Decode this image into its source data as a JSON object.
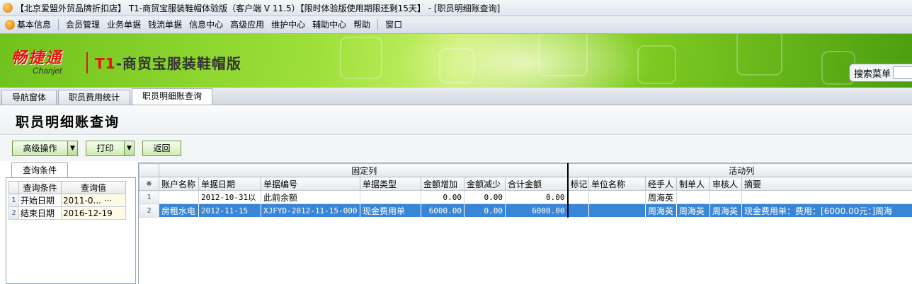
{
  "window": {
    "title": "【北京爱盟外贸品牌折扣店】 T1-商贸宝服装鞋帽体验版（客户端 V 11.5）【限时体验版使用期限还剩15天】 - [职员明细账查询]"
  },
  "menu": {
    "items": [
      "基本信息",
      "会员管理",
      "业务单据",
      "钱流单据",
      "信息中心",
      "高级应用",
      "维护中心",
      "辅助中心",
      "帮助",
      "窗口"
    ]
  },
  "banner": {
    "logo_cn": "畅捷通",
    "logo_en": "Chanjet",
    "product_prefix": "T1",
    "product_name": "-商贸宝服装鞋帽版",
    "search_label": "搜索菜单"
  },
  "tabs": [
    "导航窗体",
    "职员费用统计",
    "职员明细账查询"
  ],
  "active_tab": 2,
  "page": {
    "title": "职员明细账查询"
  },
  "toolbar": {
    "advanced": "高级操作",
    "print": "打印",
    "back": "返回"
  },
  "query_panel": {
    "tab": "查询条件",
    "headers": [
      "查询条件",
      "查询值"
    ],
    "rows": [
      {
        "n": "1",
        "label": "开始日期",
        "value": "2011-0...",
        "more": "···"
      },
      {
        "n": "2",
        "label": "结束日期",
        "value": "2016-12-19",
        "more": ""
      }
    ]
  },
  "grid": {
    "group_fixed": "固定列",
    "group_active": "活动列",
    "corner": "※",
    "columns": [
      "账户名称",
      "单据日期",
      "单据编号",
      "单据类型",
      "金额增加",
      "金额减少",
      "合计金额",
      "标记",
      "单位名称",
      "经手人",
      "制单人",
      "审核人",
      "摘要"
    ],
    "rows": [
      {
        "n": "1",
        "account": "",
        "date": "2012-10-31以",
        "code": "此前余额",
        "type": "",
        "inc": "0.00",
        "dec": "0.00",
        "total": "0.00",
        "mark": "",
        "unit": "",
        "handler": "周海英",
        "maker": "",
        "auditor": "",
        "summary": ""
      },
      {
        "n": "2",
        "account": "房租水电",
        "date": "2012-11-15",
        "code": "XJFYD-2012-11-15-000",
        "type": "现金费用单",
        "inc": "6000.00",
        "dec": "0.00",
        "total": "6000.00",
        "mark": "",
        "unit": "",
        "handler": "周海英",
        "maker": "周海英",
        "auditor": "周海英",
        "summary": "现金费用单：费用：[6000.00元：]周海"
      }
    ],
    "selected_row": 2
  }
}
